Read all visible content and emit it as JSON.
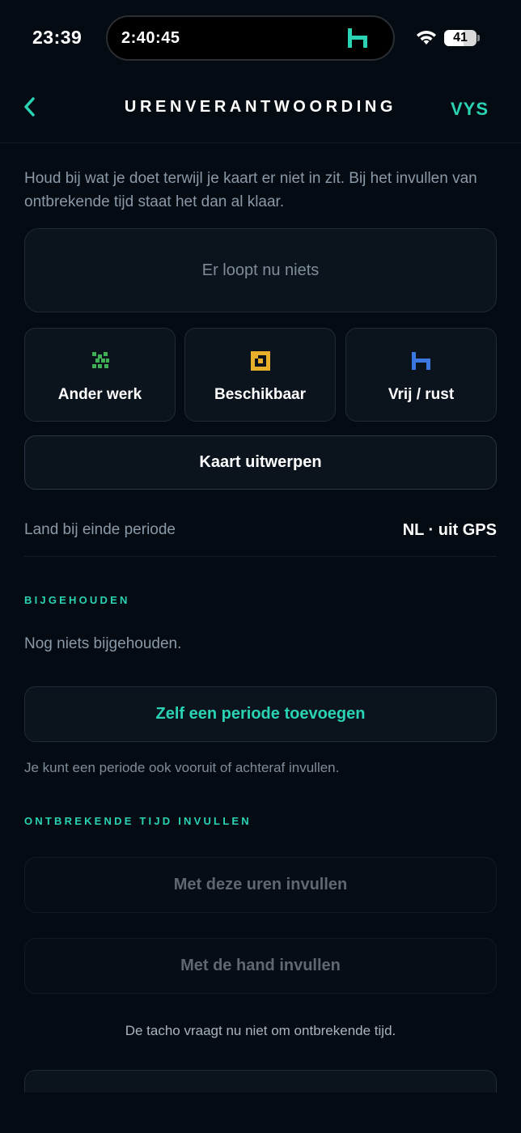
{
  "status_bar": {
    "time": "23:39",
    "island_timer": "2:40:45",
    "battery": "41"
  },
  "header": {
    "title": "URENVERANTWOORDING",
    "brand": "VYS"
  },
  "intro": "Houd bij wat je doet terwijl je kaart er niet in zit. Bij het invullen van ontbrekende tijd staat het dan al klaar.",
  "status_card": "Er loopt nu niets",
  "activities": [
    {
      "label": "Ander werk",
      "icon": "hammers-icon",
      "color": "#3fae55"
    },
    {
      "label": "Beschikbaar",
      "icon": "available-box-icon",
      "color": "#e8b02a"
    },
    {
      "label": "Vrij / rust",
      "icon": "bed-icon",
      "color": "#3a78e0"
    }
  ],
  "eject_label": "Kaart uitwerpen",
  "country": {
    "label": "Land bij einde periode",
    "value": "NL · uit GPS"
  },
  "tracked": {
    "section_title": "BIJGEHOUDEN",
    "empty_text": "Nog niets bijgehouden.",
    "add_label": "Zelf een periode toevoegen",
    "hint": "Je kunt een periode ook vooruit of achteraf invullen."
  },
  "missing": {
    "section_title": "ONTBREKENDE TIJD INVULLEN",
    "fill_hours_label": "Met deze uren invullen",
    "fill_manual_label": "Met de hand invullen",
    "note": "De tacho vraagt nu niet om ontbrekende tijd."
  },
  "colors": {
    "accent": "#2ad3b4",
    "background": "#050b12"
  }
}
